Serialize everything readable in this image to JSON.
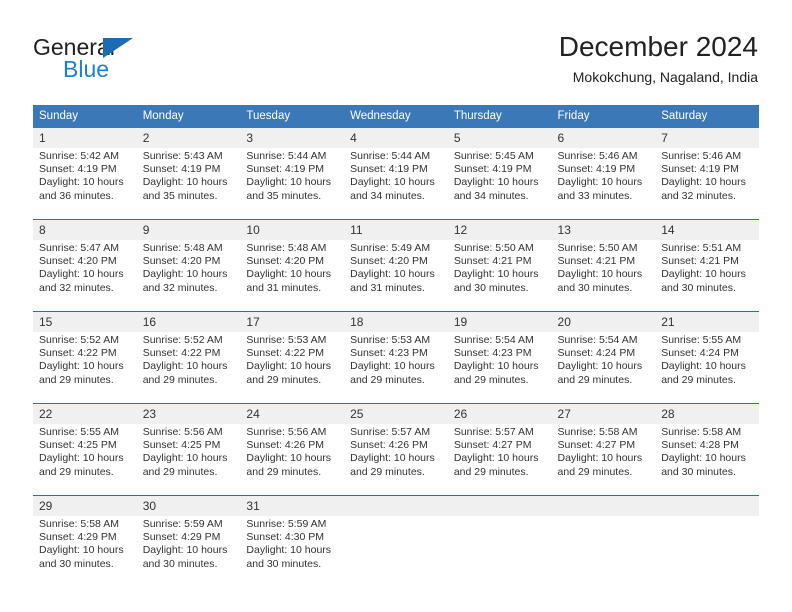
{
  "brand": {
    "name_top": "General",
    "name_bottom": "Blue",
    "color_dark": "#231f20",
    "color_blue": "#1b7fd4",
    "triangle_color": "#1b6cb3"
  },
  "header": {
    "title": "December 2024",
    "subtitle": "Mokokchung, Nagaland, India"
  },
  "theme": {
    "header_row_bg": "#3b78b7",
    "header_row_text": "#ffffff",
    "daynum_bg": "#f0f0f0",
    "row_separator": "#2a6db3",
    "body_text": "#333333"
  },
  "calendar": {
    "day_headers": [
      "Sunday",
      "Monday",
      "Tuesday",
      "Wednesday",
      "Thursday",
      "Friday",
      "Saturday"
    ],
    "weeks": [
      [
        {
          "day": "1",
          "sunrise": "Sunrise: 5:42 AM",
          "sunset": "Sunset: 4:19 PM",
          "daylight_1": "Daylight: 10 hours",
          "daylight_2": "and 36 minutes."
        },
        {
          "day": "2",
          "sunrise": "Sunrise: 5:43 AM",
          "sunset": "Sunset: 4:19 PM",
          "daylight_1": "Daylight: 10 hours",
          "daylight_2": "and 35 minutes."
        },
        {
          "day": "3",
          "sunrise": "Sunrise: 5:44 AM",
          "sunset": "Sunset: 4:19 PM",
          "daylight_1": "Daylight: 10 hours",
          "daylight_2": "and 35 minutes."
        },
        {
          "day": "4",
          "sunrise": "Sunrise: 5:44 AM",
          "sunset": "Sunset: 4:19 PM",
          "daylight_1": "Daylight: 10 hours",
          "daylight_2": "and 34 minutes."
        },
        {
          "day": "5",
          "sunrise": "Sunrise: 5:45 AM",
          "sunset": "Sunset: 4:19 PM",
          "daylight_1": "Daylight: 10 hours",
          "daylight_2": "and 34 minutes."
        },
        {
          "day": "6",
          "sunrise": "Sunrise: 5:46 AM",
          "sunset": "Sunset: 4:19 PM",
          "daylight_1": "Daylight: 10 hours",
          "daylight_2": "and 33 minutes."
        },
        {
          "day": "7",
          "sunrise": "Sunrise: 5:46 AM",
          "sunset": "Sunset: 4:19 PM",
          "daylight_1": "Daylight: 10 hours",
          "daylight_2": "and 32 minutes."
        }
      ],
      [
        {
          "day": "8",
          "sunrise": "Sunrise: 5:47 AM",
          "sunset": "Sunset: 4:20 PM",
          "daylight_1": "Daylight: 10 hours",
          "daylight_2": "and 32 minutes."
        },
        {
          "day": "9",
          "sunrise": "Sunrise: 5:48 AM",
          "sunset": "Sunset: 4:20 PM",
          "daylight_1": "Daylight: 10 hours",
          "daylight_2": "and 32 minutes."
        },
        {
          "day": "10",
          "sunrise": "Sunrise: 5:48 AM",
          "sunset": "Sunset: 4:20 PM",
          "daylight_1": "Daylight: 10 hours",
          "daylight_2": "and 31 minutes."
        },
        {
          "day": "11",
          "sunrise": "Sunrise: 5:49 AM",
          "sunset": "Sunset: 4:20 PM",
          "daylight_1": "Daylight: 10 hours",
          "daylight_2": "and 31 minutes."
        },
        {
          "day": "12",
          "sunrise": "Sunrise: 5:50 AM",
          "sunset": "Sunset: 4:21 PM",
          "daylight_1": "Daylight: 10 hours",
          "daylight_2": "and 30 minutes."
        },
        {
          "day": "13",
          "sunrise": "Sunrise: 5:50 AM",
          "sunset": "Sunset: 4:21 PM",
          "daylight_1": "Daylight: 10 hours",
          "daylight_2": "and 30 minutes."
        },
        {
          "day": "14",
          "sunrise": "Sunrise: 5:51 AM",
          "sunset": "Sunset: 4:21 PM",
          "daylight_1": "Daylight: 10 hours",
          "daylight_2": "and 30 minutes."
        }
      ],
      [
        {
          "day": "15",
          "sunrise": "Sunrise: 5:52 AM",
          "sunset": "Sunset: 4:22 PM",
          "daylight_1": "Daylight: 10 hours",
          "daylight_2": "and 29 minutes."
        },
        {
          "day": "16",
          "sunrise": "Sunrise: 5:52 AM",
          "sunset": "Sunset: 4:22 PM",
          "daylight_1": "Daylight: 10 hours",
          "daylight_2": "and 29 minutes."
        },
        {
          "day": "17",
          "sunrise": "Sunrise: 5:53 AM",
          "sunset": "Sunset: 4:22 PM",
          "daylight_1": "Daylight: 10 hours",
          "daylight_2": "and 29 minutes."
        },
        {
          "day": "18",
          "sunrise": "Sunrise: 5:53 AM",
          "sunset": "Sunset: 4:23 PM",
          "daylight_1": "Daylight: 10 hours",
          "daylight_2": "and 29 minutes."
        },
        {
          "day": "19",
          "sunrise": "Sunrise: 5:54 AM",
          "sunset": "Sunset: 4:23 PM",
          "daylight_1": "Daylight: 10 hours",
          "daylight_2": "and 29 minutes."
        },
        {
          "day": "20",
          "sunrise": "Sunrise: 5:54 AM",
          "sunset": "Sunset: 4:24 PM",
          "daylight_1": "Daylight: 10 hours",
          "daylight_2": "and 29 minutes."
        },
        {
          "day": "21",
          "sunrise": "Sunrise: 5:55 AM",
          "sunset": "Sunset: 4:24 PM",
          "daylight_1": "Daylight: 10 hours",
          "daylight_2": "and 29 minutes."
        }
      ],
      [
        {
          "day": "22",
          "sunrise": "Sunrise: 5:55 AM",
          "sunset": "Sunset: 4:25 PM",
          "daylight_1": "Daylight: 10 hours",
          "daylight_2": "and 29 minutes."
        },
        {
          "day": "23",
          "sunrise": "Sunrise: 5:56 AM",
          "sunset": "Sunset: 4:25 PM",
          "daylight_1": "Daylight: 10 hours",
          "daylight_2": "and 29 minutes."
        },
        {
          "day": "24",
          "sunrise": "Sunrise: 5:56 AM",
          "sunset": "Sunset: 4:26 PM",
          "daylight_1": "Daylight: 10 hours",
          "daylight_2": "and 29 minutes."
        },
        {
          "day": "25",
          "sunrise": "Sunrise: 5:57 AM",
          "sunset": "Sunset: 4:26 PM",
          "daylight_1": "Daylight: 10 hours",
          "daylight_2": "and 29 minutes."
        },
        {
          "day": "26",
          "sunrise": "Sunrise: 5:57 AM",
          "sunset": "Sunset: 4:27 PM",
          "daylight_1": "Daylight: 10 hours",
          "daylight_2": "and 29 minutes."
        },
        {
          "day": "27",
          "sunrise": "Sunrise: 5:58 AM",
          "sunset": "Sunset: 4:27 PM",
          "daylight_1": "Daylight: 10 hours",
          "daylight_2": "and 29 minutes."
        },
        {
          "day": "28",
          "sunrise": "Sunrise: 5:58 AM",
          "sunset": "Sunset: 4:28 PM",
          "daylight_1": "Daylight: 10 hours",
          "daylight_2": "and 30 minutes."
        }
      ],
      [
        {
          "day": "29",
          "sunrise": "Sunrise: 5:58 AM",
          "sunset": "Sunset: 4:29 PM",
          "daylight_1": "Daylight: 10 hours",
          "daylight_2": "and 30 minutes."
        },
        {
          "day": "30",
          "sunrise": "Sunrise: 5:59 AM",
          "sunset": "Sunset: 4:29 PM",
          "daylight_1": "Daylight: 10 hours",
          "daylight_2": "and 30 minutes."
        },
        {
          "day": "31",
          "sunrise": "Sunrise: 5:59 AM",
          "sunset": "Sunset: 4:30 PM",
          "daylight_1": "Daylight: 10 hours",
          "daylight_2": "and 30 minutes."
        },
        {
          "day": "",
          "sunrise": "",
          "sunset": "",
          "daylight_1": "",
          "daylight_2": ""
        },
        {
          "day": "",
          "sunrise": "",
          "sunset": "",
          "daylight_1": "",
          "daylight_2": ""
        },
        {
          "day": "",
          "sunrise": "",
          "sunset": "",
          "daylight_1": "",
          "daylight_2": ""
        },
        {
          "day": "",
          "sunrise": "",
          "sunset": "",
          "daylight_1": "",
          "daylight_2": ""
        }
      ]
    ]
  }
}
